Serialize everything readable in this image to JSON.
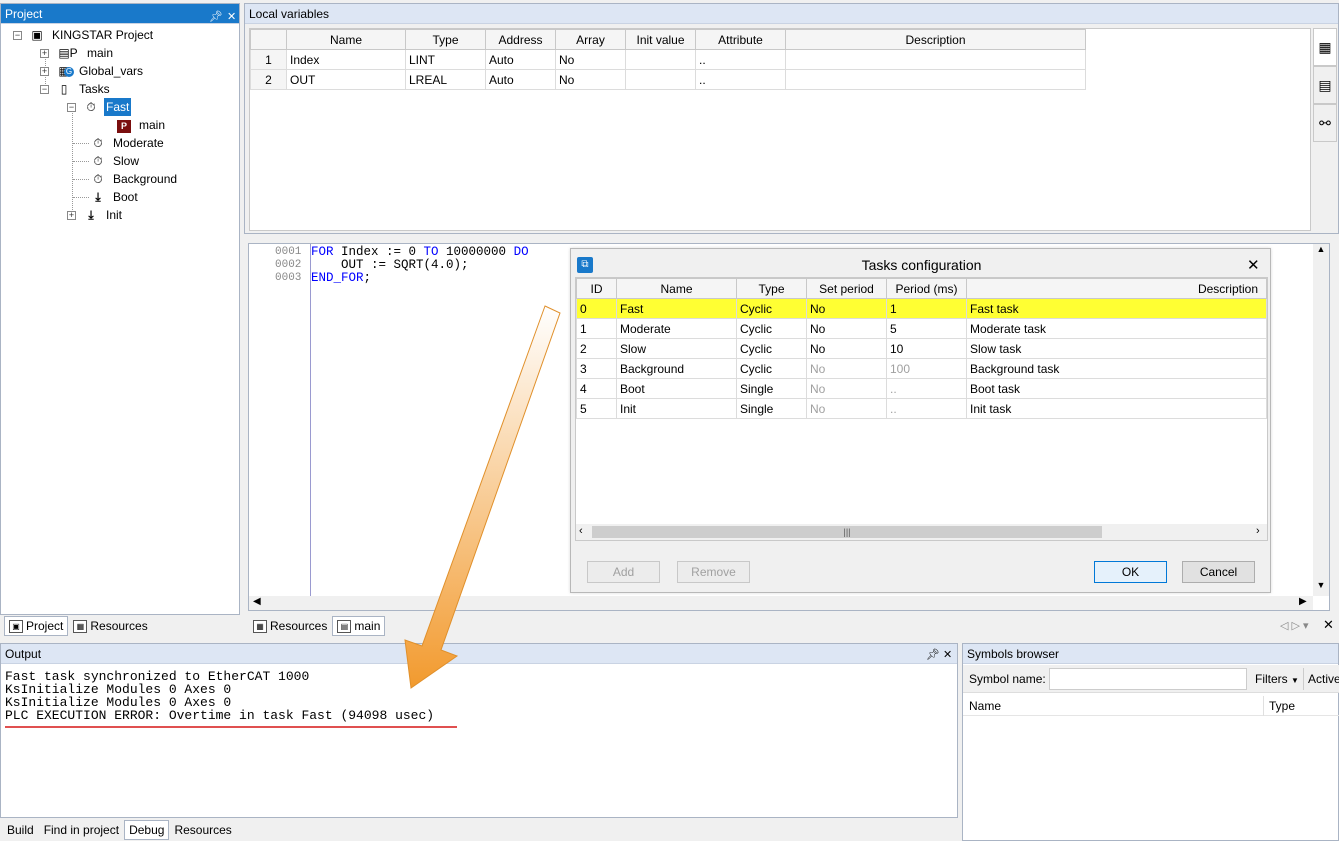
{
  "project_panel": {
    "title": "Project",
    "pin": "↕",
    "close": "✕",
    "tree": {
      "root": "KINGSTAR Project",
      "main": "main",
      "global_vars": "Global_vars",
      "tasks": "Tasks",
      "fast": "Fast",
      "fast_main": "main",
      "moderate": "Moderate",
      "slow": "Slow",
      "background": "Background",
      "boot": "Boot",
      "init": "Init"
    },
    "tabs": {
      "project": "Project",
      "resources": "Resources"
    }
  },
  "local_vars": {
    "title": "Local variables",
    "columns": [
      "",
      "Name",
      "Type",
      "Address",
      "Array",
      "Init value",
      "Attribute",
      "Description"
    ],
    "rows": [
      {
        "n": "1",
        "name": "Index",
        "type": "LINT",
        "address": "Auto",
        "array": "No",
        "init": "",
        "attribute": "..",
        "desc": ""
      },
      {
        "n": "2",
        "name": "OUT",
        "type": "LREAL",
        "address": "Auto",
        "array": "No",
        "init": "",
        "attribute": "..",
        "desc": ""
      }
    ]
  },
  "editor": {
    "line_numbers": [
      "0001",
      "0002",
      "0003"
    ],
    "lines": [
      {
        "kw1": "FOR",
        "mid": " Index := 0 ",
        "kw2": "TO",
        "end": " 10000000 ",
        "kw3": "DO"
      },
      {
        "text": "    OUT := SQRT(4.0);"
      },
      {
        "kw1": "END_FOR",
        "end": ";"
      }
    ],
    "tabs": {
      "resources": "Resources",
      "main": "main"
    }
  },
  "tasks_dialog": {
    "title": "Tasks configuration",
    "close": "✕",
    "columns": [
      "ID",
      "Name",
      "Type",
      "Set period",
      "Period (ms)",
      "Description"
    ],
    "rows": [
      {
        "id": "0",
        "name": "Fast",
        "type": "Cyclic",
        "set": "No",
        "period": "1",
        "desc": "Fast task",
        "sel": true,
        "dim": false
      },
      {
        "id": "1",
        "name": "Moderate",
        "type": "Cyclic",
        "set": "No",
        "period": "5",
        "desc": "Moderate task",
        "sel": false,
        "dim": false
      },
      {
        "id": "2",
        "name": "Slow",
        "type": "Cyclic",
        "set": "No",
        "period": "10",
        "desc": "Slow task",
        "sel": false,
        "dim": false
      },
      {
        "id": "3",
        "name": "Background",
        "type": "Cyclic",
        "set": "No",
        "period": "100",
        "desc": "Background task",
        "sel": false,
        "dim": true
      },
      {
        "id": "4",
        "name": "Boot",
        "type": "Single",
        "set": "No",
        "period": "..",
        "desc": "Boot task",
        "sel": false,
        "dim": true
      },
      {
        "id": "5",
        "name": "Init",
        "type": "Single",
        "set": "No",
        "period": "..",
        "desc": "Init task",
        "sel": false,
        "dim": true
      }
    ],
    "buttons": {
      "add": "Add",
      "remove": "Remove",
      "ok": "OK",
      "cancel": "Cancel"
    }
  },
  "output": {
    "title": "Output",
    "lines": [
      "Fast task synchronized to EtherCAT 1000",
      "KsInitialize Modules 0 Axes 0",
      "KsInitialize Modules 0 Axes 0",
      "PLC EXECUTION ERROR: Overtime in task Fast (94098 usec)"
    ],
    "tabs": {
      "build": "Build",
      "find": "Find in project",
      "debug": "Debug",
      "resources": "Resources"
    }
  },
  "symbols": {
    "title": "Symbols browser",
    "symbol_name_label": "Symbol name:",
    "filters": "Filters",
    "active": "Active",
    "col_name": "Name",
    "col_type": "Type"
  },
  "colors": {
    "accent": "#1979ca",
    "selected_row": "#ffff33",
    "error_underline": "#e05050",
    "arrow": "#f29a2e"
  }
}
